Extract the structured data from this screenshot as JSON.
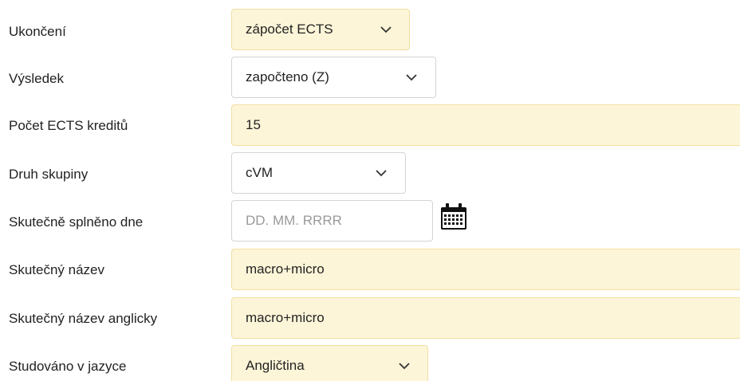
{
  "rows": [
    {
      "label": "Ukončení",
      "value": "zápočet ECTS"
    },
    {
      "label": "Výsledek",
      "value": "započteno (Z)"
    },
    {
      "label": "Počet ECTS kreditů",
      "value": "15"
    },
    {
      "label": "Druh skupiny",
      "value": "cVM"
    },
    {
      "label": "Skutečně splněno dne",
      "value": "",
      "placeholder": "DD. MM. RRRR"
    },
    {
      "label": "Skutečný název",
      "value": "macro+micro"
    },
    {
      "label": "Skutečný název anglicky",
      "value": "macro+micro"
    },
    {
      "label": "Studováno v jazyce",
      "value": "Angličtina"
    }
  ],
  "colors": {
    "required_field_bg": "#fdf5d8",
    "required_field_border": "#f1dfa0",
    "optional_field_border": "#d4d4d4",
    "placeholder_text": "#9a9a9a"
  },
  "icons": {
    "select_arrow": "chevron-down-icon",
    "date_picker": "calendar-icon"
  }
}
